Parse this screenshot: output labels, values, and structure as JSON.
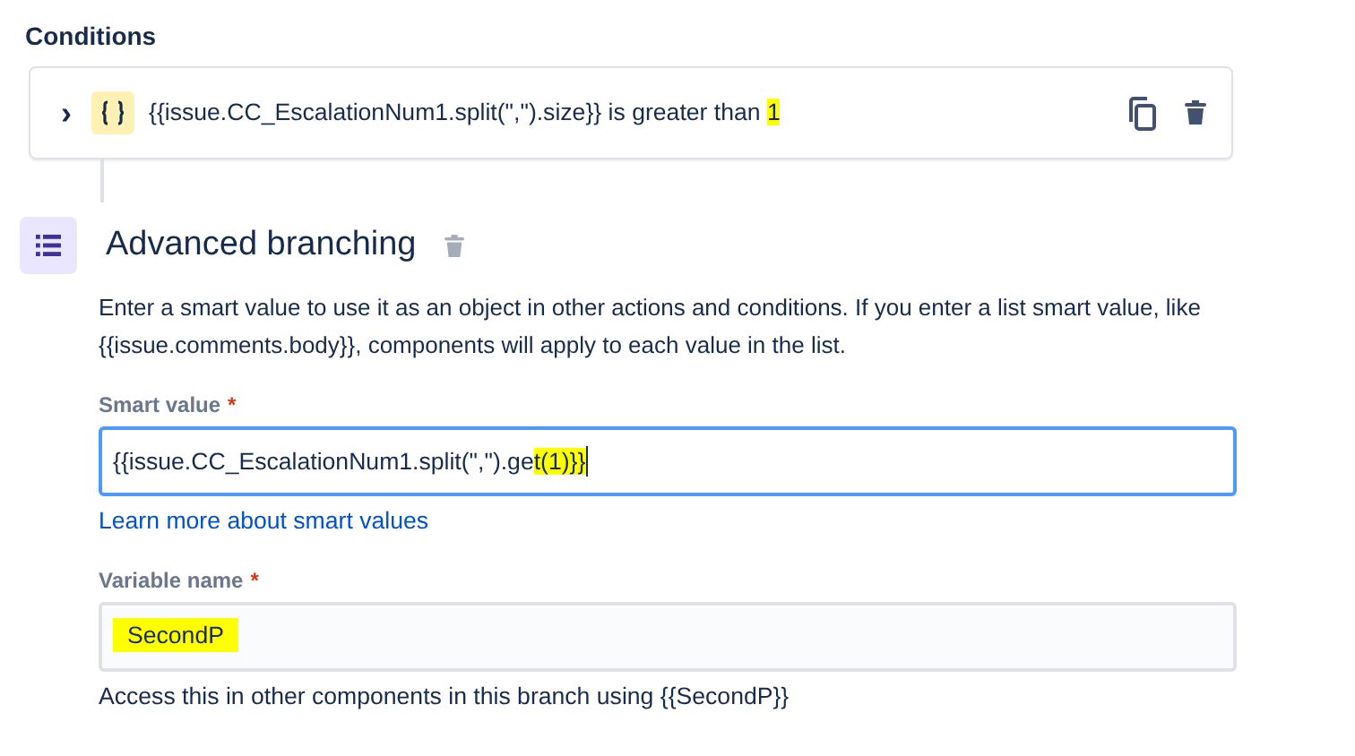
{
  "conditions": {
    "heading": "Conditions",
    "items": [
      {
        "expand": "›",
        "text": "{{issue.CC_EscalationNum1.split(\",\").size}} is greater than",
        "highlight": "1",
        "expanded": false
      }
    ]
  },
  "branch": {
    "title": "Advanced branching",
    "description": "Enter a smart value to use it as an object in other actions and conditions. If you enter a list smart value, like {{issue.comments.body}}, components will apply to each value in the list.",
    "fields": [
      {
        "label": "Smart value",
        "required_mark": "*",
        "value": "{{issue.CC_EscalationNum1.split(\",\").ge",
        "highlight": "t(1)}}",
        "focused": true,
        "link": "Learn more about smart values"
      },
      {
        "label": "Variable name",
        "required_mark": "*",
        "highlight": "SecondP",
        "focused": false,
        "help": "Access this in other components in this branch using {{SecondP}}"
      }
    ]
  }
}
